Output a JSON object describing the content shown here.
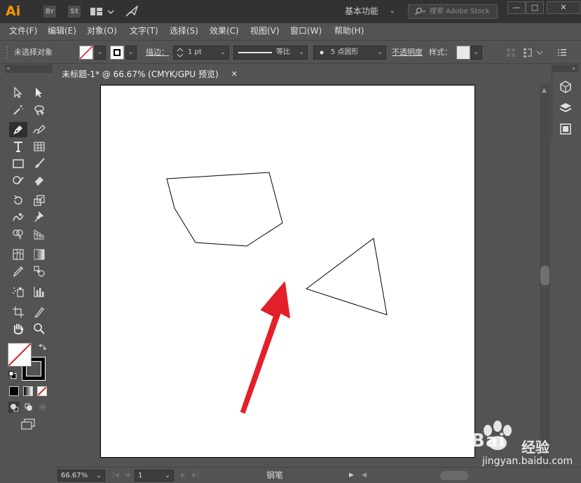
{
  "titlebar": {
    "app_logo": "Ai",
    "bridge_label": "Br",
    "stock_label": "St",
    "workspace_label": "基本功能",
    "search_placeholder": "搜索 Adobe Stock",
    "minimize": "—",
    "maximize": "□",
    "close": "✕"
  },
  "menu": {
    "items": [
      "文件(F)",
      "编辑(E)",
      "对象(O)",
      "文字(T)",
      "选择(S)",
      "效果(C)",
      "视图(V)",
      "窗口(W)",
      "帮助(H)"
    ]
  },
  "control": {
    "selection_status": "未选择对象",
    "stroke_label": "描边：",
    "stroke_weight": "1 pt",
    "profile_label": "等比",
    "brush_label": "5 点圆形",
    "opacity_label": "不透明度",
    "style_label": "样式："
  },
  "document": {
    "tab_title": "未标题-1* @ 66.67% (CMYK/GPU 预览)",
    "tab_close": "✕"
  },
  "status": {
    "zoom": "66.67%",
    "page": "1",
    "current_tool": "钢笔"
  },
  "watermark": {
    "brand": "Bai",
    "brand2": "经验",
    "url": "jingyan.baidu.com"
  },
  "colors": {
    "arrow": "#e3202a",
    "logo": "#ff9a00"
  }
}
